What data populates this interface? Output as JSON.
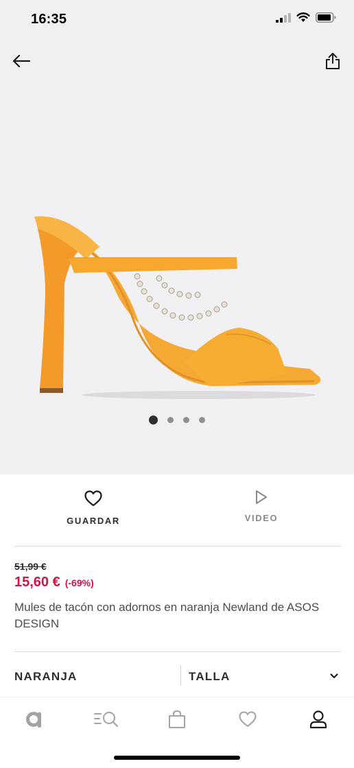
{
  "status_bar": {
    "time": "16:35"
  },
  "hero": {
    "icons": {
      "back": "arrow-left-icon",
      "share": "share-icon"
    },
    "carousel": {
      "total": 4,
      "active": 1
    }
  },
  "actions": {
    "save_label": "GUARDAR",
    "video_label": "VIDEO"
  },
  "product": {
    "old_price": "51,99 €",
    "price": "15,60 €",
    "discount": "(-69%)",
    "title": "Mules de tacón con adornos en naranja Newland de ASOS DESIGN"
  },
  "selectors": {
    "color": "NARANJA",
    "size_label": "TALLA"
  },
  "tab_bar": {
    "items": [
      "home-icon",
      "search-icon",
      "bag-icon",
      "saved-icon",
      "account-icon"
    ],
    "active": "account-icon"
  },
  "colors": {
    "sale_red": "#d01345",
    "text_dark": "#2d2d2d",
    "hero_bg": "#f1f0f2",
    "shoe_orange": "#f7a32a"
  }
}
